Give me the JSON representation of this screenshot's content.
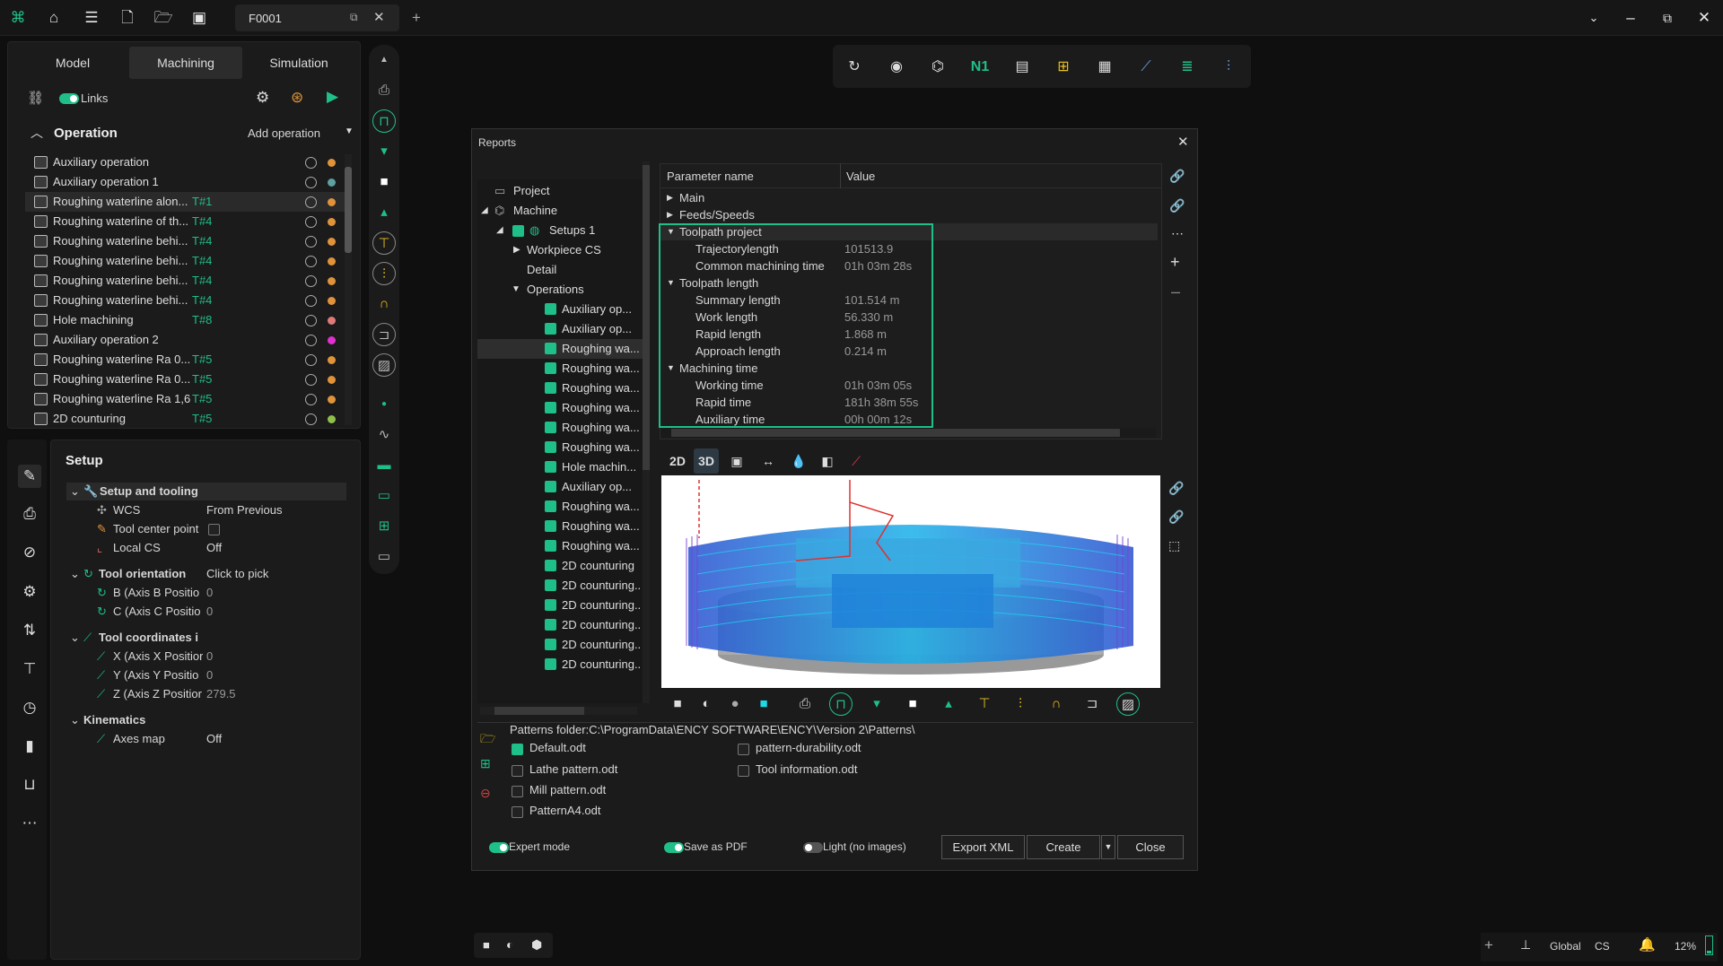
{
  "app": {
    "doc_tab": "F0001"
  },
  "left_tabs": [
    "Model",
    "Machining",
    "Simulation"
  ],
  "links_label": "Links",
  "operation": {
    "header": "Operation",
    "add_label": "Add operation",
    "items": [
      {
        "name": "Auxiliary operation",
        "tool": "",
        "color": "#e0933a",
        "sel": false
      },
      {
        "name": "Auxiliary operation 1",
        "tool": "",
        "color": "#5fa0a0",
        "sel": false
      },
      {
        "name": "Roughing waterline alon...",
        "tool": "T#1",
        "color": "#e0933a",
        "sel": true
      },
      {
        "name": "Roughing waterline of th...",
        "tool": "T#4",
        "color": "#e0933a",
        "sel": false
      },
      {
        "name": "Roughing waterline behi...",
        "tool": "T#4",
        "color": "#e0933a",
        "sel": false
      },
      {
        "name": "Roughing waterline behi...",
        "tool": "T#4",
        "color": "#e0933a",
        "sel": false
      },
      {
        "name": "Roughing waterline behi...",
        "tool": "T#4",
        "color": "#e0933a",
        "sel": false
      },
      {
        "name": "Roughing waterline behi...",
        "tool": "T#4",
        "color": "#e0933a",
        "sel": false
      },
      {
        "name": "Hole machining",
        "tool": "T#8",
        "color": "#e07a7a",
        "sel": false
      },
      {
        "name": "Auxiliary operation 2",
        "tool": "",
        "color": "#e030d0",
        "sel": false
      },
      {
        "name": "Roughing waterline Ra 0...",
        "tool": "T#5",
        "color": "#e0933a",
        "sel": false
      },
      {
        "name": "Roughing waterline Ra 0...",
        "tool": "T#5",
        "color": "#e0933a",
        "sel": false
      },
      {
        "name": "Roughing waterline Ra 1,6",
        "tool": "T#5",
        "color": "#e0933a",
        "sel": false
      },
      {
        "name": "2D counturing",
        "tool": "T#5",
        "color": "#8fc04a",
        "sel": false
      }
    ]
  },
  "setup": {
    "title": "Setup",
    "group1": "Setup and tooling",
    "wcs": {
      "label": "WCS",
      "value": "From Previous"
    },
    "tcp": {
      "label": "Tool center point"
    },
    "localcs": {
      "label": "Local CS",
      "value": "Off"
    },
    "tool_orient": {
      "label": "Tool orientation",
      "value": "Click to pick"
    },
    "b_axis": {
      "label": "B (Axis B Positio",
      "value": "0"
    },
    "c_axis": {
      "label": "C (Axis C Positio",
      "value": "0"
    },
    "tool_coords": {
      "label": "Tool coordinates i"
    },
    "x_axis": {
      "label": "X (Axis X Positior",
      "value": "0"
    },
    "y_axis": {
      "label": "Y (Axis Y Positio",
      "value": "0"
    },
    "z_axis": {
      "label": "Z (Axis Z Positior",
      "value": "279.5"
    },
    "kinematics": "Kinematics",
    "axes_map": {
      "label": "Axes map",
      "value": "Off"
    }
  },
  "reports": {
    "title": "Reports",
    "tree": {
      "project": "Project",
      "machine": "Machine",
      "setups": "Setups 1",
      "workpiece": "Workpiece CS",
      "detail": "Detail",
      "operations": "Operations",
      "ops": [
        "Auxiliary op...",
        "Auxiliary op...",
        "Roughing wa...",
        "Roughing wa...",
        "Roughing wa...",
        "Roughing wa...",
        "Roughing wa...",
        "Roughing wa...",
        "Hole machin...",
        "Auxiliary op...",
        "Roughing wa...",
        "Roughing wa...",
        "Roughing wa...",
        "2D counturing",
        "2D counturing...",
        "2D counturing...",
        "2D counturing...",
        "2D counturing...",
        "2D counturing..."
      ]
    },
    "params": {
      "col_name": "Parameter name",
      "col_value": "Value",
      "main": "Main",
      "feeds": "Feeds/Speeds",
      "toolpath_project": "Toolpath project",
      "trajectory": {
        "name": "Trajectorylength",
        "value": "101513.9"
      },
      "common_time": {
        "name": "Common machining time",
        "value": "01h 03m 28s"
      },
      "toolpath_length": "Toolpath length",
      "summary": {
        "name": "Summary length",
        "value": "101.514 m"
      },
      "work": {
        "name": "Work length",
        "value": "56.330 m"
      },
      "rapid_len": {
        "name": "Rapid length",
        "value": "1.868 m"
      },
      "approach": {
        "name": "Approach length",
        "value": "0.214 m"
      },
      "machining_time": "Machining time",
      "working_time": {
        "name": "Working time",
        "value": "01h 03m 05s"
      },
      "rapid_time": {
        "name": "Rapid time",
        "value": "181h 38m 55s"
      },
      "aux_time": {
        "name": "Auxiliary time",
        "value": "00h 00m 12s"
      }
    },
    "view_2d": "2D",
    "view_3d": "3D",
    "patterns_folder": "Patterns folder:C:\\ProgramData\\ENCY SOFTWARE\\ENCY\\Version 2\\Patterns\\",
    "patterns": [
      {
        "name": "Default.odt",
        "checked": true
      },
      {
        "name": "Lathe pattern.odt",
        "checked": false
      },
      {
        "name": "Mill pattern.odt",
        "checked": false
      },
      {
        "name": "PatternA4.odt",
        "checked": false
      },
      {
        "name": "pattern-durability.odt",
        "checked": false
      },
      {
        "name": "Tool information.odt",
        "checked": false
      }
    ],
    "expert_mode": "Expert mode",
    "save_pdf": "Save as PDF",
    "light": "Light (no images)",
    "export_xml": "Export XML",
    "create": "Create",
    "close": "Close"
  },
  "status": {
    "cs_global": "Global",
    "cs": "CS",
    "zoom": "12%"
  },
  "colors": {
    "accent": "#1fbf8a",
    "highlight_box": "#1fbf8a",
    "toolpath_cyan": "#1ac8e8",
    "toolpath_purple": "#6a40c8"
  }
}
